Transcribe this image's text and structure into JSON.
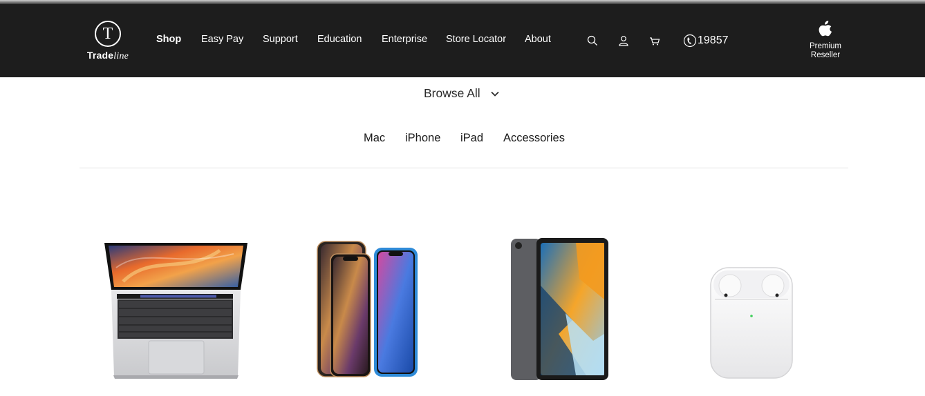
{
  "brand": {
    "logo_letter": "T",
    "name_bold": "Trade",
    "name_light": "line"
  },
  "nav": {
    "items": [
      {
        "label": "Shop",
        "active": true
      },
      {
        "label": "Easy Pay",
        "active": false
      },
      {
        "label": "Support",
        "active": false
      },
      {
        "label": "Education",
        "active": false
      },
      {
        "label": "Enterprise",
        "active": false
      },
      {
        "label": "Store Locator",
        "active": false
      },
      {
        "label": "About",
        "active": false
      }
    ]
  },
  "header_icons": [
    "search-icon",
    "account-icon",
    "cart-icon"
  ],
  "hotline": {
    "icon": "phone-icon",
    "number": "19857"
  },
  "reseller_badge": {
    "line1": "Premium",
    "line2": "Reseller"
  },
  "browse": {
    "label": "Browse All",
    "icon": "chevron-down-icon"
  },
  "categories": [
    "Mac",
    "iPhone",
    "iPad",
    "Accessories"
  ],
  "products": [
    {
      "name": "macbook-pro",
      "depicts": "laptop"
    },
    {
      "name": "iphone",
      "depicts": "phones"
    },
    {
      "name": "ipad-pro",
      "depicts": "tablet"
    },
    {
      "name": "airpods",
      "depicts": "earbuds case"
    }
  ],
  "colors": {
    "header_bg": "#1d1d1d",
    "header_text": "#ffffff",
    "body_text": "#1a1a1a",
    "divider": "#e2e2e2"
  }
}
